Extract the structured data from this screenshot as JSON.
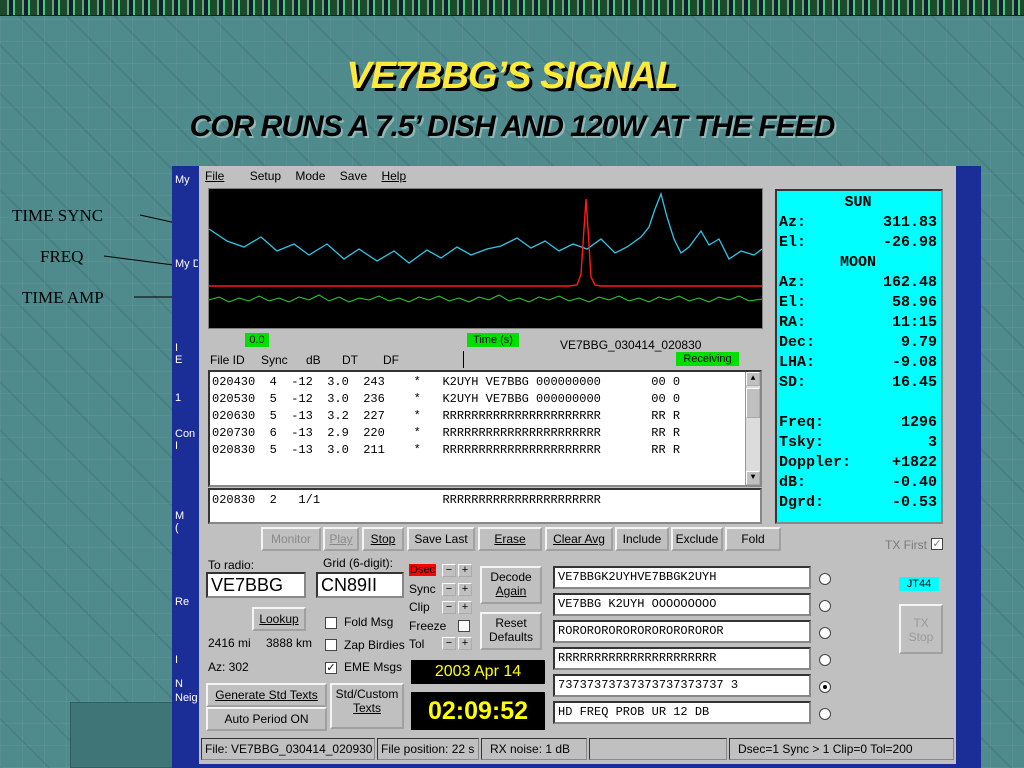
{
  "slide": {
    "title": "VE7BBG’S SIGNAL",
    "subtitle": "COR RUNS A 7.5’ DISH AND 120W AT THE FEED"
  },
  "annotations": {
    "time_sync": "TIME SYNC",
    "freq": "FREQ",
    "time_amp": "TIME AMP"
  },
  "side_window": {
    "labels": [
      "My",
      "My D",
      "I",
      "E",
      "1",
      "Con",
      "I",
      "M",
      "(",
      "Re",
      "I",
      "N",
      "Neig"
    ]
  },
  "menu": {
    "file": "File",
    "setup": "Setup",
    "mode": "Mode",
    "save": "Save",
    "help": "Help"
  },
  "graph": {
    "traces": [
      {
        "name": "time-sync",
        "color": "#33c5e8"
      },
      {
        "name": "freq",
        "color": "#ff1a1a"
      },
      {
        "name": "time-amp",
        "color": "#2fd22f"
      }
    ],
    "zero_label": "0.0",
    "time_label": "Time (s)",
    "file_label": "VE7BBG_030414_020830"
  },
  "decode_list": {
    "headers": {
      "file_id": "File ID",
      "sync": "Sync",
      "db": "dB",
      "dt": "DT",
      "df": "DF"
    },
    "status": "Receiving",
    "status_color": "#00e000",
    "rows": [
      "020430  4  -12  3.0  243    *   K2UYH VE7BBG 000000000       00 0",
      "020530  5  -12  3.0  236    *   K2UYH VE7BBG 000000000       00 0",
      "020630  5  -13  3.2  227    *   RRRRRRRRRRRRRRRRRRRRRR       RR R",
      "020730  6  -13  2.9  220    *   RRRRRRRRRRRRRRRRRRRRRR       RR R",
      "020830  5  -13  3.0  211    *   RRRRRRRRRRRRRRRRRRRRRR       RR R"
    ],
    "average_row": "020830  2   1/1                 RRRRRRRRRRRRRRRRRRRRRR"
  },
  "buttons": {
    "monitor": "Monitor",
    "play": "Play",
    "stop": "Stop",
    "save_last": "Save Last",
    "erase": "Erase",
    "clear_avg": "Clear Avg",
    "include": "Include",
    "exclude": "Exclude",
    "fold": "Fold",
    "lookup": "Lookup",
    "generate_std_texts": "Generate Std Texts",
    "auto_period": "Auto Period ON",
    "std_custom_line1": "Std/Custom",
    "std_custom_line2": "Texts",
    "decode_again_line1": "Decode",
    "decode_again_line2": "Again",
    "reset_defaults_line1": "Reset",
    "reset_defaults_line2": "Defaults",
    "tx_stop_line1": "TX",
    "tx_stop_line2": "Stop"
  },
  "tx_first": {
    "label": "TX First",
    "checked": true
  },
  "station": {
    "to_radio_label": "To radio:",
    "to_radio": "VE7BBG",
    "grid_label": "Grid (6-digit):",
    "grid": "CN89II",
    "distance_mi": "2416 mi",
    "distance_km": "3888 km",
    "azimuth": "Az: 302"
  },
  "checkboxes": {
    "fold_msg": {
      "label": "Fold Msg",
      "checked": false
    },
    "zap_birdies": {
      "label": "Zap Birdies",
      "checked": false
    },
    "eme_msgs": {
      "label": "EME Msgs",
      "checked": true
    }
  },
  "params": {
    "dsec": "Dsec",
    "dsec_color": "#ff0000",
    "sync": "Sync",
    "clip": "Clip",
    "freeze": "Freeze",
    "tol": "Tol"
  },
  "clock": {
    "date": "2003 Apr 14",
    "time": "02:09:52"
  },
  "tx_messages": [
    {
      "text": "VE7BBGK2UYHVE7BBGK2UYH",
      "selected": false
    },
    {
      "text": "VE7BBG K2UYH OOOOOOOOO",
      "selected": false
    },
    {
      "text": "ROROROROROROROROROROROR",
      "selected": false
    },
    {
      "text": "RRRRRRRRRRRRRRRRRRRRRR",
      "selected": false
    },
    {
      "text": "73737373737373737373737 3",
      "selected": true
    },
    {
      "text": "HD FREQ PROB UR 12 DB",
      "selected": false
    }
  ],
  "mode_badge": "JT44",
  "astro": {
    "sun_header": "SUN",
    "moon_header": "MOON",
    "sun": [
      {
        "k": "Az:",
        "v": "311.83"
      },
      {
        "k": "El:",
        "v": "-26.98"
      }
    ],
    "moon": [
      {
        "k": "Az:",
        "v": "162.48"
      },
      {
        "k": "El:",
        "v": "58.96"
      },
      {
        "k": "RA:",
        "v": "11:15"
      },
      {
        "k": "Dec:",
        "v": "9.79"
      },
      {
        "k": "LHA:",
        "v": "-9.08"
      },
      {
        "k": "SD:",
        "v": "16.45"
      }
    ],
    "misc": [
      {
        "k": "Freq:",
        "v": "1296"
      },
      {
        "k": "Tsky:",
        "v": "3"
      },
      {
        "k": "Doppler:",
        "v": "+1822"
      },
      {
        "k": "dB:",
        "v": "-0.40"
      },
      {
        "k": "Dgrd:",
        "v": "-0.53"
      }
    ]
  },
  "statusbar": {
    "file": "File: VE7BBG_030414_020930",
    "position": "File position:  22 s",
    "rx_noise": "RX noise: 1 dB",
    "empty": "",
    "settings": "Dsec=1  Sync > 1  Clip=0  Tol=200"
  }
}
